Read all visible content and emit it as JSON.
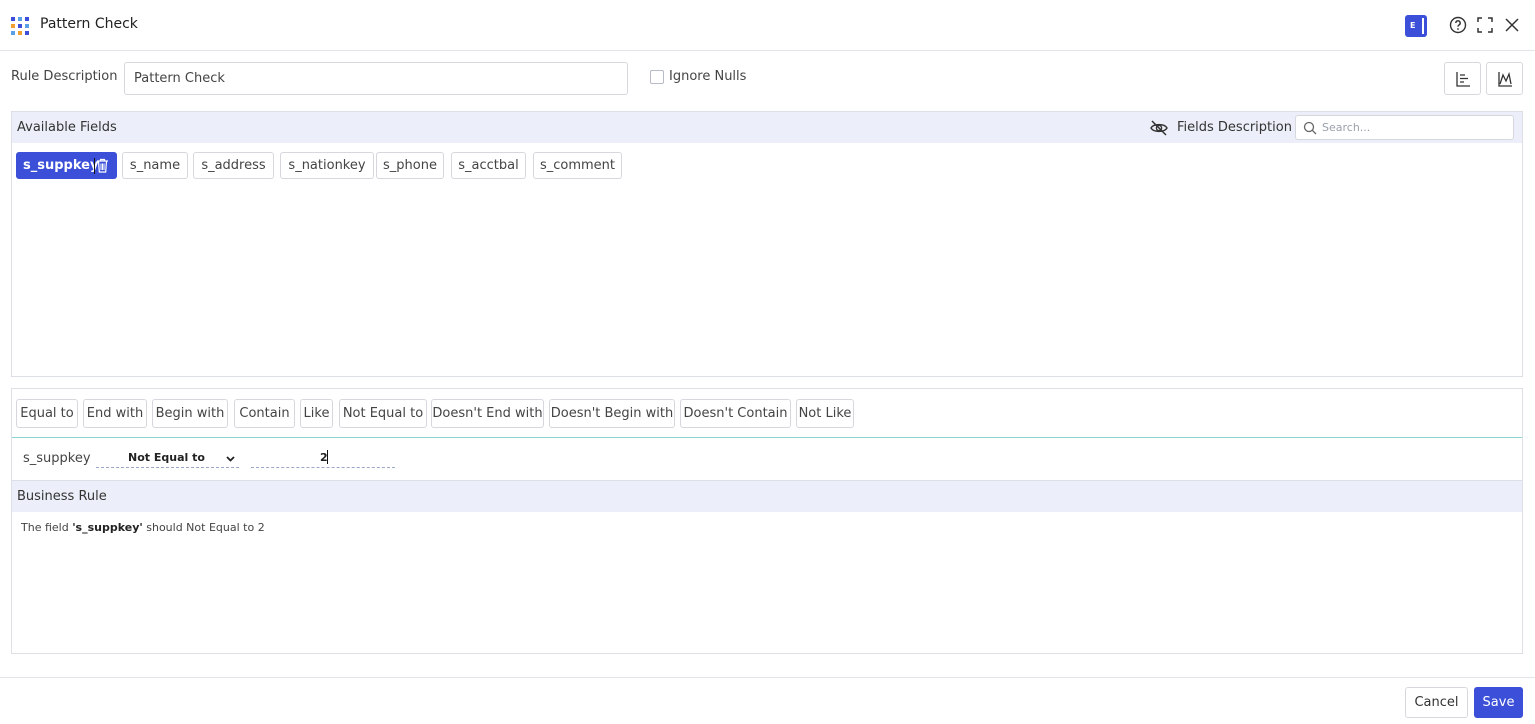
{
  "window": {
    "title": "Pattern Check",
    "badge_letter": "E"
  },
  "rule": {
    "label": "Rule Description",
    "value": "Pattern Check",
    "ignore_nulls_label": "Ignore Nulls",
    "ignore_nulls_checked": false
  },
  "fields_panel": {
    "title": "Available Fields",
    "description_label": "Fields Description",
    "search_placeholder": "Search...",
    "fields": [
      {
        "label": "s_suppkey",
        "selected": true
      },
      {
        "label": "s_name",
        "selected": false
      },
      {
        "label": "s_address",
        "selected": false
      },
      {
        "label": "s_nationkey",
        "selected": false
      },
      {
        "label": "s_phone",
        "selected": false
      },
      {
        "label": "s_acctbal",
        "selected": false
      },
      {
        "label": "s_comment",
        "selected": false
      }
    ]
  },
  "operators": [
    "Equal to",
    "End with",
    "Begin with",
    "Contain",
    "Like",
    "Not Equal to",
    "Doesn't End with",
    "Doesn't Begin with",
    "Doesn't Contain",
    "Not Like"
  ],
  "condition": {
    "field": "s_suppkey",
    "operator": "Not Equal to",
    "value": "2"
  },
  "business_rule": {
    "title": "Business Rule",
    "text_prefix": "The field ",
    "field": "'s_suppkey'",
    "text_suffix": " should Not Equal to 2"
  },
  "footer": {
    "cancel_label": "Cancel",
    "save_label": "Save"
  },
  "colors": {
    "accent": "#3b4fd8",
    "panel_header": "#eceff9",
    "separator": "#8cd3d3"
  }
}
